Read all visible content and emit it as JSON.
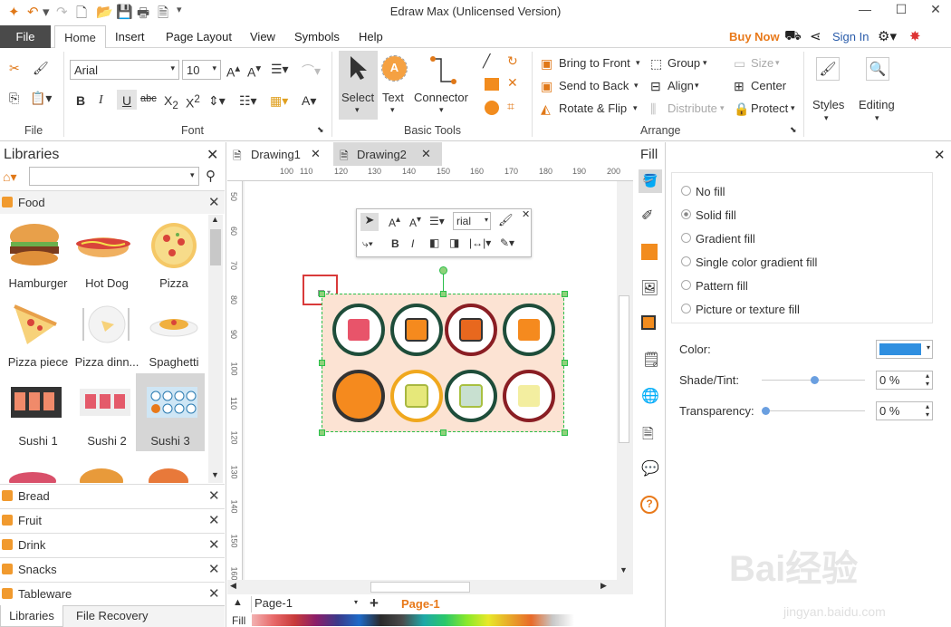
{
  "window": {
    "title": "Edraw Max (Unlicensed Version)"
  },
  "menu": {
    "file": "File",
    "home": "Home",
    "insert": "Insert",
    "page_layout": "Page Layout",
    "view": "View",
    "symbols": "Symbols",
    "help": "Help",
    "buy_now": "Buy Now",
    "sign_in": "Sign In"
  },
  "ribbon": {
    "file_group": "File",
    "font": {
      "name": "Arial",
      "size": "10",
      "group": "Font"
    },
    "basic_tools": {
      "select": "Select",
      "text": "Text",
      "connector": "Connector",
      "group": "Basic Tools"
    },
    "arrange": {
      "bring_to_front": "Bring to Front",
      "send_to_back": "Send to Back",
      "rotate_flip": "Rotate & Flip",
      "group": "Group",
      "align": "Align",
      "distribute": "Distribute",
      "size": "Size",
      "center": "Center",
      "protect": "Protect",
      "label": "Arrange"
    },
    "styles": "Styles",
    "editing": "Editing"
  },
  "libraries": {
    "title": "Libraries",
    "search_placeholder": "",
    "open_category": "Food",
    "shapes": [
      "Hamburger",
      "Hot Dog",
      "Pizza",
      "Pizza piece",
      "Pizza dinn...",
      "Spaghetti",
      "Sushi 1",
      "Sushi 2",
      "Sushi 3"
    ],
    "categories": [
      "Bread",
      "Fruit",
      "Drink",
      "Snacks",
      "Tableware"
    ],
    "bottom_tabs": [
      "Libraries",
      "File Recovery"
    ]
  },
  "documents": {
    "tabs": [
      "Drawing1",
      "Drawing2"
    ],
    "active": "Drawing2"
  },
  "ruler": {
    "h_ticks": [
      "100",
      "110",
      "120",
      "130",
      "140",
      "150",
      "160",
      "170",
      "180",
      "190",
      "200"
    ],
    "v_ticks": [
      "50",
      "60",
      "70",
      "80",
      "90",
      "100",
      "110",
      "120",
      "130",
      "140",
      "150",
      "160"
    ]
  },
  "floating_toolbar": {
    "font": "rial"
  },
  "pages": {
    "current": "Page-1",
    "tab": "Page-1"
  },
  "fill_strip_label": "Fill",
  "fill_panel": {
    "title": "Fill",
    "options": [
      "No fill",
      "Solid fill",
      "Gradient fill",
      "Single color gradient fill",
      "Pattern fill",
      "Picture or texture fill"
    ],
    "selected": "Solid fill",
    "color_label": "Color:",
    "color_value": "#2f8fe0",
    "shade_label": "Shade/Tint:",
    "shade_value": "0 %",
    "transparency_label": "Transparency:",
    "transparency_value": "0 %"
  },
  "watermark": {
    "text": "Bai经验",
    "sub": "jingyan.baidu.com"
  },
  "colors": {
    "accent_orange": "#e8791a",
    "file_tab": "#4a4a4a",
    "selection": "#2bbf4a",
    "highlight_box": "#d93a3a"
  }
}
